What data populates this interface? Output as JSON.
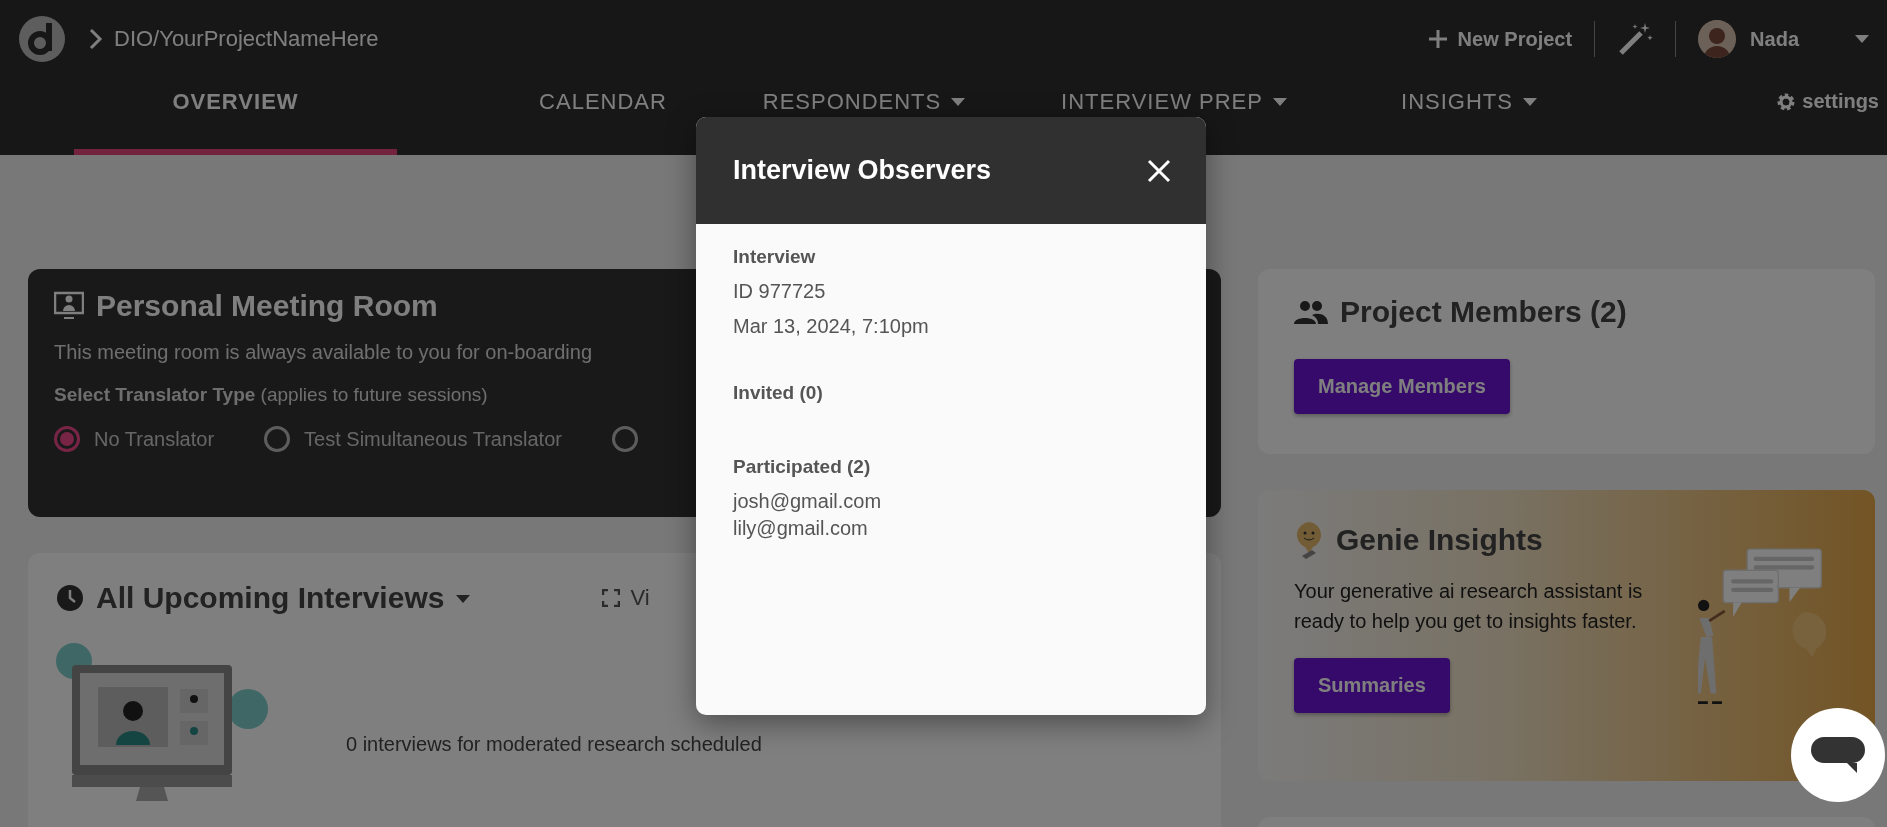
{
  "header": {
    "breadcrumb": "DIO/YourProjectNameHere",
    "new_project": "New Project",
    "user": {
      "name": "Nada"
    }
  },
  "nav": {
    "tabs": [
      {
        "label": "OVERVIEW",
        "selected": true,
        "dropdown": false
      },
      {
        "label": "CALENDAR",
        "selected": false,
        "dropdown": false
      },
      {
        "label": "RESPONDENTS",
        "selected": false,
        "dropdown": true
      },
      {
        "label": "INTERVIEW PREP",
        "selected": false,
        "dropdown": true
      },
      {
        "label": "INSIGHTS",
        "selected": false,
        "dropdown": true
      }
    ],
    "settings": "settings"
  },
  "meeting_room": {
    "title": "Personal Meeting Room",
    "description": "This meeting room is always available to you for on-boarding",
    "translator_label": "**Select Translator Type** (applies to future sessions)",
    "options": [
      {
        "label": "No Translator",
        "selected": true
      },
      {
        "label": "Test Simultaneous Translator",
        "selected": false
      },
      {
        "selected": false
      }
    ]
  },
  "upcoming": {
    "title": "All Upcoming Interviews",
    "view_link": "Vi",
    "empty_text": "0 interviews for moderated research scheduled"
  },
  "members": {
    "title": "Project Members (2)",
    "button": "Manage Members"
  },
  "genie": {
    "title": "Genie Insights",
    "description": "Your generative ai research assistant is ready to help you get to insights faster.",
    "button": "Summaries"
  },
  "modal": {
    "title": "Interview Observers",
    "interview_heading": "Interview",
    "interview_id": "ID 977725",
    "interview_date": "Mar 13, 2024, 7:10pm",
    "sections": [
      {
        "heading": "Invited (0)"
      },
      {
        "heading": "Participated (2)",
        "emails": [
          "josh@gmail.com",
          "lily@gmail.com"
        ]
      }
    ]
  }
}
